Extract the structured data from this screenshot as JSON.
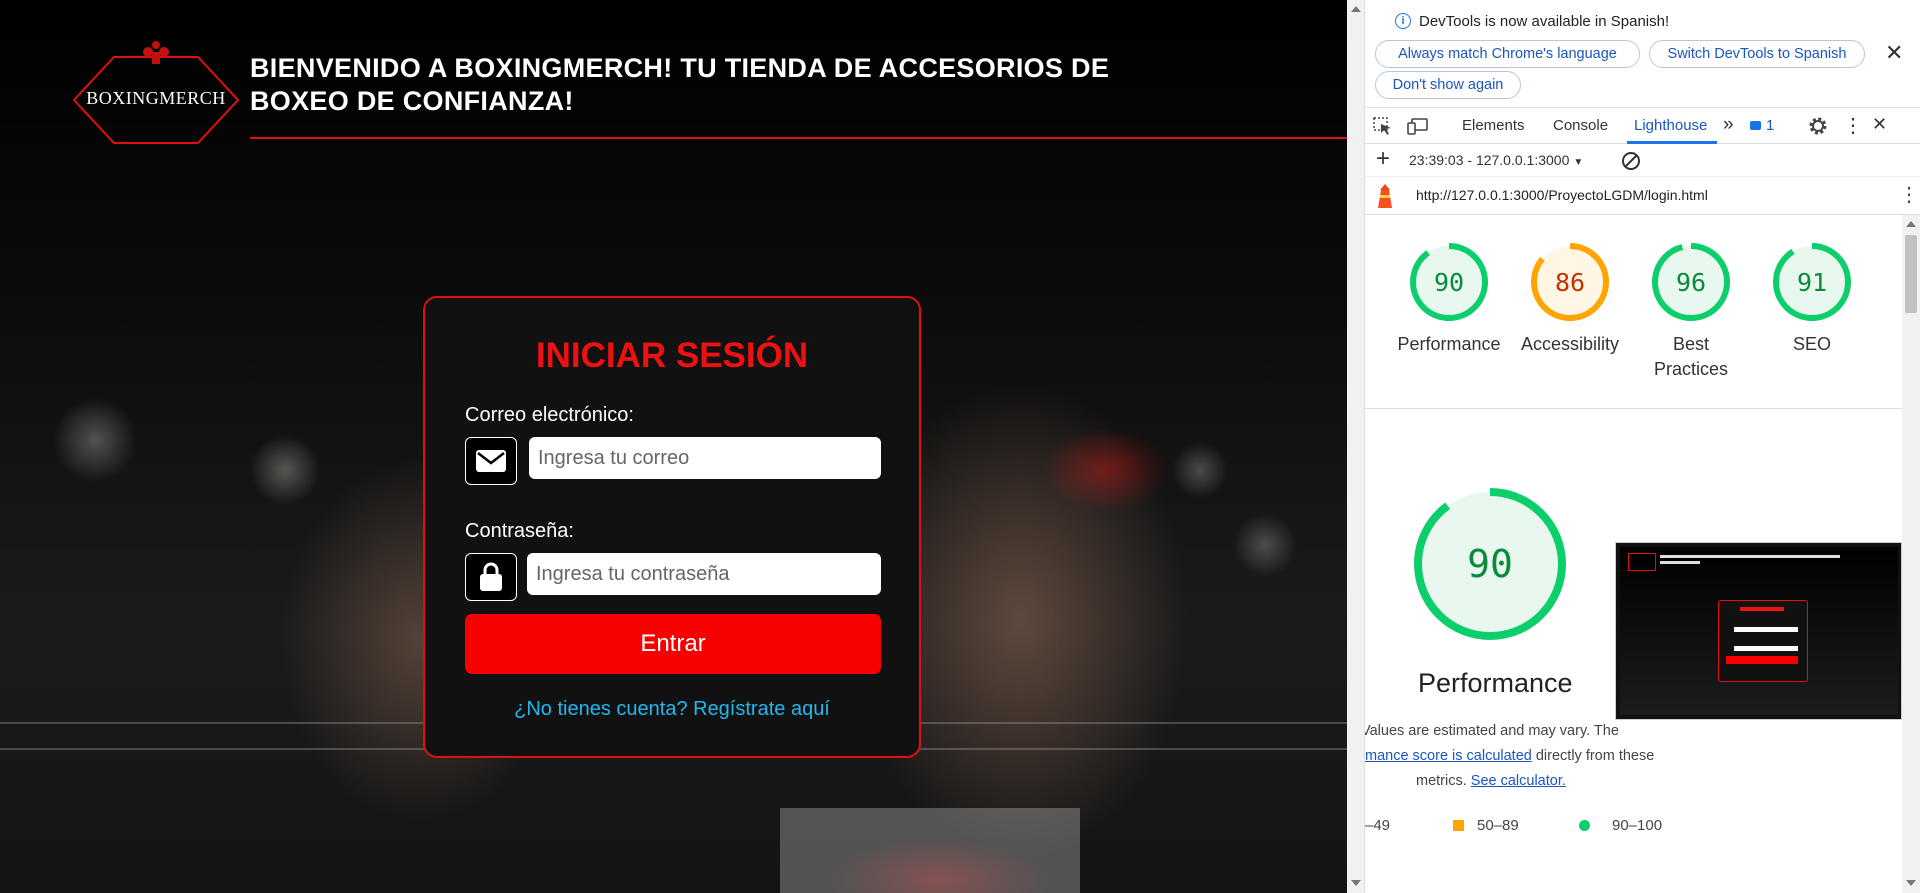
{
  "site": {
    "logo_text": "BOXINGMERCH",
    "headline": "BIENVENIDO A BOXINGMERCH! TU TIENDA DE ACCESORIOS DE BOXEO DE CONFIANZA!",
    "login": {
      "title": "INICIAR SESIÓN",
      "email_label": "Correo electrónico:",
      "email_placeholder": "Ingresa tu correo",
      "password_label": "Contraseña:",
      "password_placeholder": "Ingresa tu contraseña",
      "submit_label": "Entrar",
      "register_link": "¿No tienes cuenta? Regístrate aquí"
    }
  },
  "devtools": {
    "info_message": "DevTools is now available in Spanish!",
    "info_buttons": [
      "Always match Chrome's language",
      "Switch DevTools to Spanish",
      "Don't show again"
    ],
    "tabs": [
      "Elements",
      "Console",
      "Lighthouse"
    ],
    "active_tab": "Lighthouse",
    "issues_count": "1",
    "report_selector": "23:39:03 - 127.0.0.1:3000",
    "url": "http://127.0.0.1:3000/ProyectoLGDM/login.html",
    "scores": [
      {
        "label_line1": "Performance",
        "label_line2": "",
        "value": "90",
        "color": "#0cce6b",
        "bg": "#e8f8ee",
        "text_color": "#0a8a3a"
      },
      {
        "label_line1": "Accessibility",
        "label_line2": "",
        "value": "86",
        "color": "#ffa400",
        "bg": "#fff6e6",
        "text_color": "#c33300"
      },
      {
        "label_line1": "Best",
        "label_line2": "Practices",
        "value": "96",
        "color": "#0cce6b",
        "bg": "#e8f8ee",
        "text_color": "#0a8a3a"
      },
      {
        "label_line1": "SEO",
        "label_line2": "",
        "value": "91",
        "color": "#0cce6b",
        "bg": "#e8f8ee",
        "text_color": "#0a8a3a"
      }
    ],
    "big_score": {
      "value": "90",
      "label": "Performance"
    },
    "description": {
      "line1": "Values are estimated and may vary. The",
      "link1": "mance score is calculated",
      "line2_rest": " directly from these",
      "line3": "metrics. ",
      "link2": "See calculator."
    },
    "legend": [
      "–49",
      "50–89",
      "90–100"
    ],
    "colors": {
      "good": "#0cce6b",
      "average": "#ffa400",
      "accent": "#1a73e8",
      "brand_red": "#e01010"
    }
  }
}
